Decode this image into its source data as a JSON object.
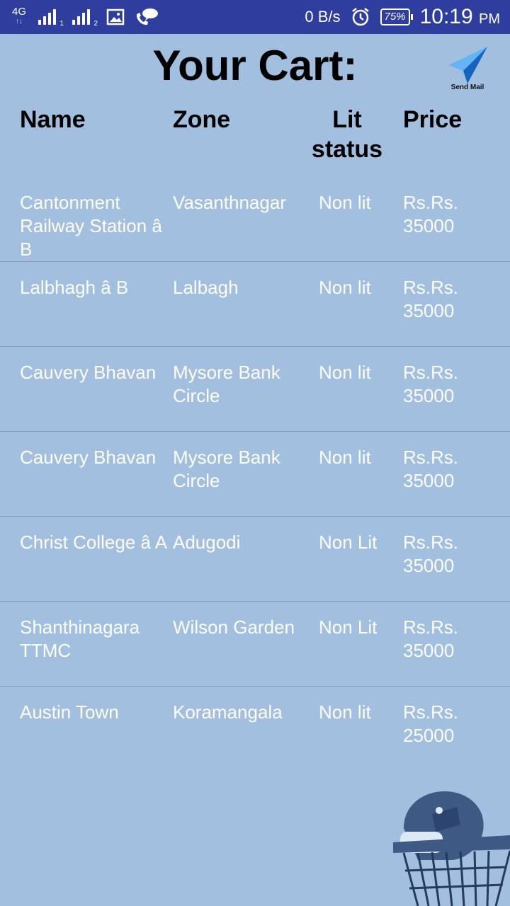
{
  "status_bar": {
    "network": "4G",
    "sim1": "1",
    "sim2": "2",
    "speed": "0 B/s",
    "battery": "75%",
    "time": "10:19",
    "ampm": "PM"
  },
  "header": {
    "title": "Your Cart:",
    "send_mail_label": "Send Mail"
  },
  "table": {
    "headers": {
      "name": "Name",
      "zone": "Zone",
      "lit_line1": "Lit",
      "lit_line2": "status",
      "price": "Price"
    },
    "rows": [
      {
        "name": "Cantonment Railway Station â B",
        "zone": "Vasanthnagar",
        "lit": "Non lit",
        "price": "Rs.Rs. 35000"
      },
      {
        "name": "Lalbhagh â B",
        "zone": "Lalbagh",
        "lit": "Non lit",
        "price": "Rs.Rs. 35000"
      },
      {
        "name": "Cauvery Bhavan",
        "zone": "Mysore Bank Circle",
        "lit": "Non lit",
        "price": "Rs.Rs. 35000"
      },
      {
        "name": "Cauvery Bhavan",
        "zone": "Mysore Bank Circle",
        "lit": "Non lit",
        "price": "Rs.Rs. 35000"
      },
      {
        "name": "Christ College â A",
        "zone": "Adugodi",
        "lit": "Non Lit",
        "price": "Rs.Rs. 35000"
      },
      {
        "name": "Shanthinagara TTMC",
        "zone": "Wilson Garden",
        "lit": "Non Lit",
        "price": "Rs.Rs. 35000"
      },
      {
        "name": "Austin Town",
        "zone": "Koramangala",
        "lit": "Non lit",
        "price": "Rs.Rs. 25000"
      }
    ]
  },
  "colors": {
    "status_bar": "#2f3e9e",
    "background": "#a3bfdf",
    "divider": "#7e9cbf",
    "send_icon": "#1e88e5"
  },
  "icons": [
    "network-4g-icon",
    "signal-icon",
    "gallery-icon",
    "phone-chat-icon",
    "alarm-icon",
    "battery-icon",
    "send-mail-icon"
  ]
}
